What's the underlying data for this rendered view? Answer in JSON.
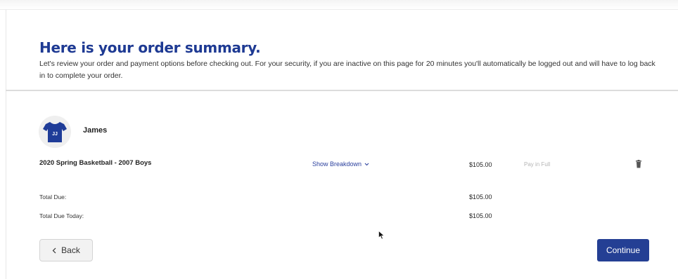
{
  "header": {
    "title": "Here is your order summary.",
    "description": "Let's review your order and payment options before checking out. For your security, if you are inactive on this page for 20 minutes you'll automatically be logged out and will have to log back in to complete your order."
  },
  "player": {
    "name": "James",
    "jersey_text": "JJ",
    "avatar_icon": "jersey-icon"
  },
  "order_item": {
    "name": "2020 Spring Basketball - 2007 Boys",
    "breakdown_label": "Show Breakdown",
    "price": "$105.00",
    "payment_option": "Pay in Full",
    "delete_icon": "trash-icon"
  },
  "totals": {
    "total_due_label": "Total Due:",
    "total_due_value": "$105.00",
    "total_due_today_label": "Total Due Today:",
    "total_due_today_value": "$105.00"
  },
  "actions": {
    "back_label": "Back",
    "continue_label": "Continue"
  },
  "colors": {
    "accent": "#1e3a93",
    "button": "#243f94"
  }
}
